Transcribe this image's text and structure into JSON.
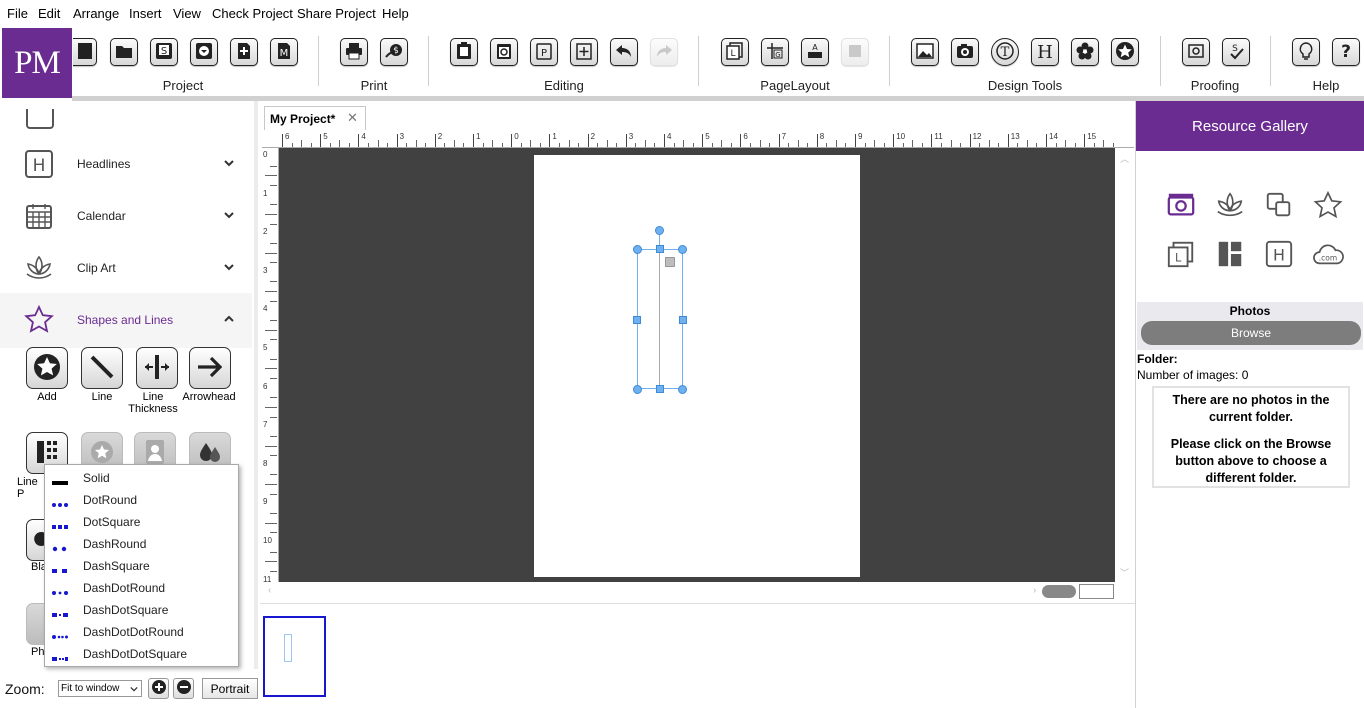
{
  "menu": [
    "File",
    "Edit",
    "Arrange",
    "Insert",
    "View",
    "Check Project",
    "Share Project",
    "Help"
  ],
  "logo": "PM",
  "toolbar": {
    "groups": [
      {
        "label": "Project"
      },
      {
        "label": "Print"
      },
      {
        "label": "Editing"
      },
      {
        "label": "PageLayout"
      },
      {
        "label": "Design Tools"
      },
      {
        "label": "Proofing"
      },
      {
        "label": "Help"
      }
    ]
  },
  "left": {
    "categories": [
      {
        "label": "Headlines",
        "icon": "headline-icon"
      },
      {
        "label": "Calendar",
        "icon": "calendar-icon"
      },
      {
        "label": "Clip Art",
        "icon": "lotus-icon"
      },
      {
        "label": "Shapes and Lines",
        "icon": "star-outline-icon",
        "expanded": true
      }
    ],
    "shape_tools": [
      {
        "label": "Add",
        "icon": "star-circle-icon"
      },
      {
        "label": "Line",
        "icon": "line-diagonal-icon"
      },
      {
        "label": "Line Thickness",
        "icon": "line-thickness-icon"
      },
      {
        "label": "Arrowhead",
        "icon": "arrow-right-icon"
      }
    ],
    "row2": [
      {
        "label": "Line P",
        "icon": "line-pattern-icon"
      },
      {
        "label": "",
        "icon": "star-badge-icon"
      },
      {
        "label": "",
        "icon": "portrait-icon"
      },
      {
        "label": "",
        "icon": "drops-icon"
      }
    ],
    "row3_label": "Bla",
    "row4_label": "Ph",
    "zoom": {
      "label": "Zoom:",
      "value": "Fit to window",
      "orientation": "Portrait"
    }
  },
  "line_pattern_menu": [
    {
      "label": "Solid"
    },
    {
      "label": "DotRound"
    },
    {
      "label": "DotSquare"
    },
    {
      "label": "DashRound"
    },
    {
      "label": "DashSquare"
    },
    {
      "label": "DashDotRound"
    },
    {
      "label": "DashDotSquare"
    },
    {
      "label": "DashDotDotRound"
    },
    {
      "label": "DashDotDotSquare"
    }
  ],
  "document": {
    "tab_title": "My Project*",
    "ruler_h": [
      "6",
      "5",
      "4",
      "3",
      "2",
      "1",
      "0",
      "1",
      "2",
      "3",
      "4",
      "5",
      "6",
      "7",
      "8",
      "9",
      "10",
      "11",
      "12",
      "13",
      "14",
      "15"
    ],
    "ruler_v": [
      "0",
      "1",
      "2",
      "3",
      "4",
      "5",
      "6",
      "7",
      "8",
      "9",
      "10",
      "11"
    ]
  },
  "right": {
    "header": "Resource Gallery",
    "photos_label": "Photos",
    "browse_label": "Browse",
    "folder_label": "Folder:",
    "count_label": "Number of images: 0",
    "message_1": "There are no photos in the current folder.",
    "message_2": "Please click on the Browse button above to choose a different folder."
  },
  "colors": {
    "brand": "#6b2c91",
    "selection": "#6fb1f0",
    "canvas": "#414141"
  }
}
